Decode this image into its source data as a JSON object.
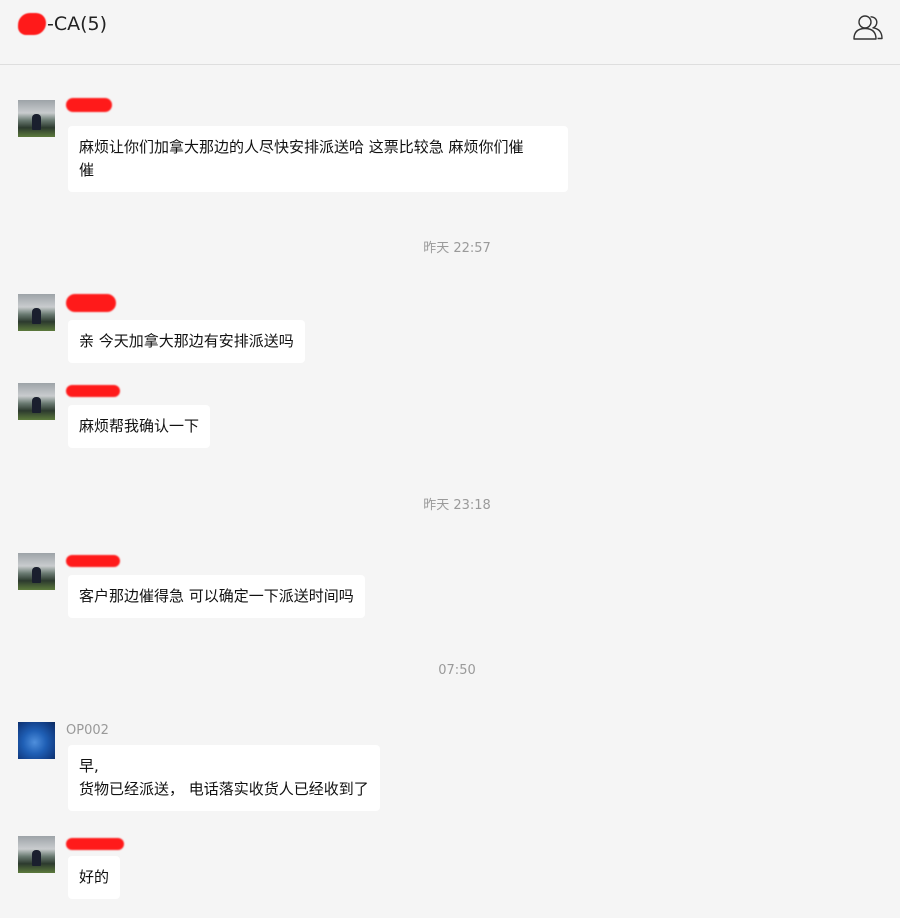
{
  "header": {
    "title": "-CA(5)",
    "members_icon": "people-icon"
  },
  "messages": [
    {
      "text": "麻烦让你们加拿大那边的人尽快安排派送哈 这票比较急 麻烦你们催\n催"
    },
    {
      "text": "亲 今天加拿大那边有安排派送吗"
    },
    {
      "text": "麻烦帮我确认一下"
    },
    {
      "text": "客户那边催得急 可以确定一下派送时间吗"
    },
    {
      "sender": "OP002",
      "text": "早,\n货物已经派送， 电话落实收货人已经收到了"
    },
    {
      "text": "好的"
    }
  ],
  "timestamps": [
    "昨天 22:57",
    "昨天 23:18",
    "07:50"
  ],
  "colors": {
    "background": "#f5f5f5",
    "bubble": "#ffffff",
    "redaction": "#ff1a1a"
  }
}
